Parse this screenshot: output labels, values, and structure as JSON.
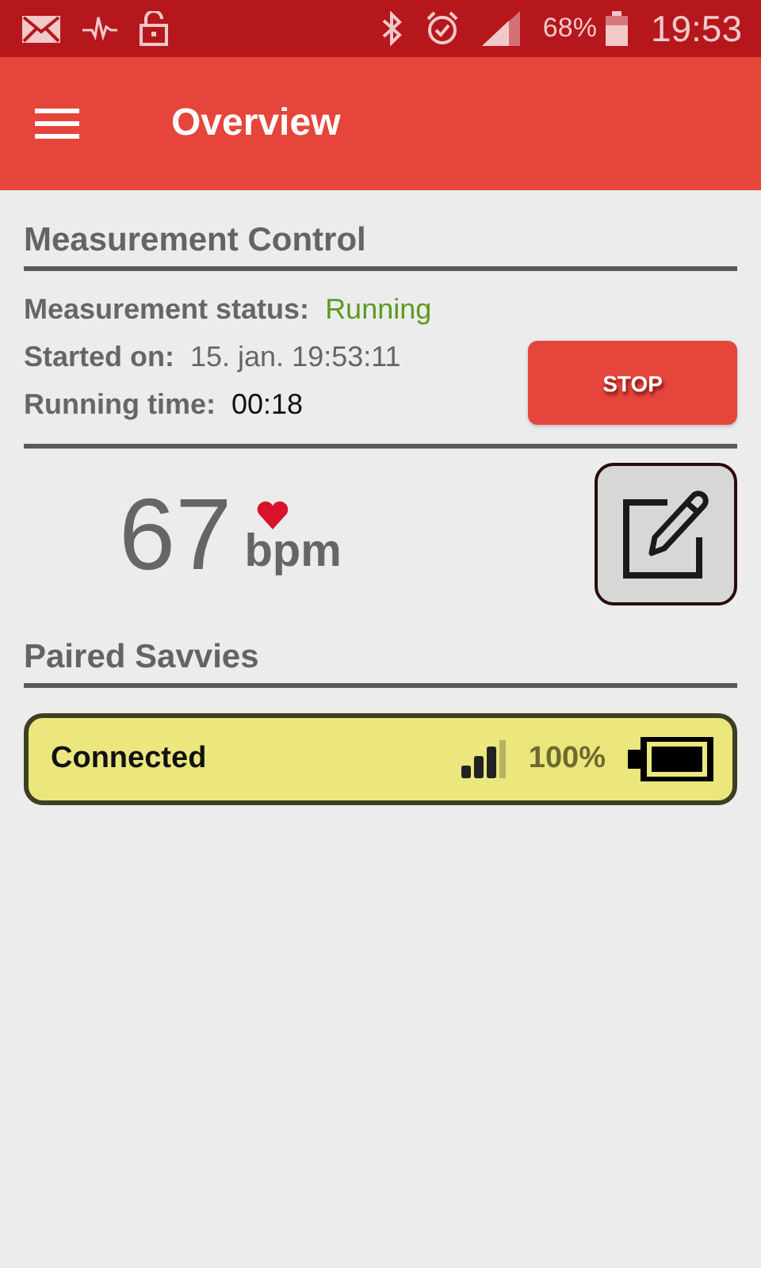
{
  "status_bar": {
    "battery": "68%",
    "time": "19:53"
  },
  "app_bar": {
    "title": "Overview"
  },
  "measurement_control": {
    "heading": "Measurement Control",
    "rows": [
      {
        "label": "Measurement status:",
        "value": "Running",
        "kind": "status"
      },
      {
        "label": "Started on:",
        "value": "15. jan. 19:53:11",
        "kind": "muted"
      },
      {
        "label": "Running time:",
        "value": "00:18",
        "kind": "plain"
      }
    ],
    "stop_button": "STOP"
  },
  "heart_rate": {
    "value": "67",
    "unit": "bpm"
  },
  "paired_savvies": {
    "heading": "Paired Savvies",
    "devices": [
      {
        "status": "Connected",
        "battery": "100%"
      }
    ]
  }
}
